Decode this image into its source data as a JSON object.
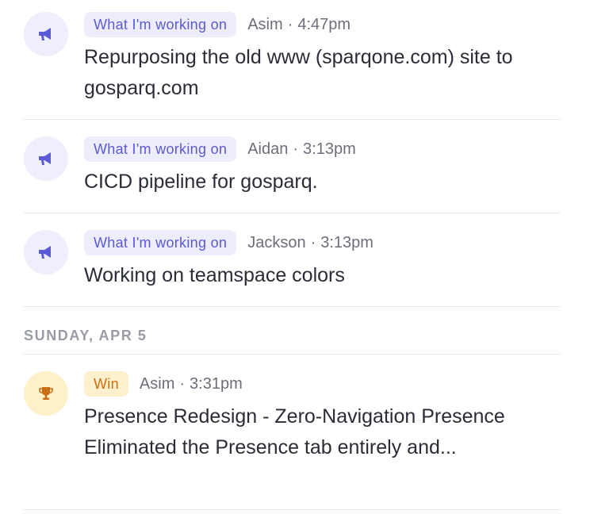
{
  "feed": {
    "entries": [
      {
        "tag": "What I'm working on",
        "author": "Asim",
        "separator": "·",
        "time": "4:47pm",
        "text": "Repurposing the old www (sparqone.com) site to gosparq.com",
        "icon": "megaphone-icon"
      },
      {
        "tag": "What I'm working on",
        "author": "Aidan",
        "separator": "·",
        "time": "3:13pm",
        "text": "CICD pipeline for gosparq.",
        "icon": "megaphone-icon"
      },
      {
        "tag": "What I'm working on",
        "author": "Jackson",
        "separator": "·",
        "time": "3:13pm",
        "text": "Working on teamspace colors",
        "icon": "megaphone-icon"
      }
    ],
    "day_header": "SUNDAY, APR 5",
    "win_entry": {
      "tag": "Win",
      "author": "Asim",
      "separator": "·",
      "time": "3:31pm",
      "text": "Presence Redesign - Zero-Navigation Presence Eliminated the Presence tab entirely and...",
      "icon": "trophy-icon"
    }
  },
  "colors": {
    "update_accent": "#5b5ad6",
    "update_bg": "#ededfb",
    "win_accent": "#c86e14",
    "win_bg": "#fdf0cc",
    "body_text": "#2b2d36",
    "meta_text": "#6c6f79"
  }
}
